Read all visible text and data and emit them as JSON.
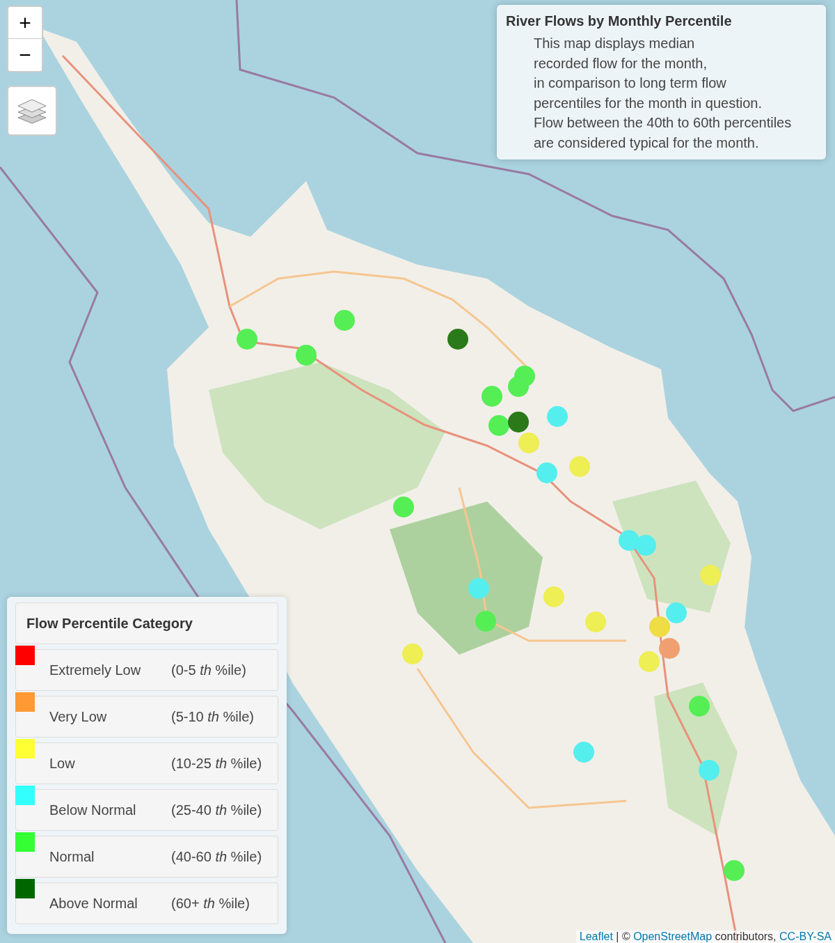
{
  "zoom_controls": {
    "zoom_in": "+",
    "zoom_out": "−"
  },
  "info_box": {
    "title": "River Flows by Monthly Percentile",
    "lines": [
      "This map displays median",
      "recorded flow for the month,",
      "in comparison to long term flow",
      "percentiles for the month in question.",
      "Flow between the 40th to 60th percentiles",
      "are considered typical for the month."
    ]
  },
  "markers": [
    {
      "color": "#55ee55"
    },
    {
      "color": "#55ee55"
    },
    {
      "color": "#55ee55"
    },
    {
      "color": "#2a7a1a"
    },
    {
      "color": "#55ee55"
    },
    {
      "color": "#55ee55"
    },
    {
      "color": "#55ee55"
    },
    {
      "color": "#55ee55"
    },
    {
      "color": "#eeee55"
    },
    {
      "color": "#2a7a1a"
    },
    {
      "color": "#55eeee"
    },
    {
      "color": "#55eeee"
    },
    {
      "color": "#eeee55"
    },
    {
      "color": "#55ee55"
    },
    {
      "color": "#55eeee"
    },
    {
      "color": "#55eeee"
    },
    {
      "color": "#eeee55"
    },
    {
      "color": "#55eeee"
    },
    {
      "color": "#eeee55"
    },
    {
      "color": "#55ee55"
    },
    {
      "color": "#eeee55"
    },
    {
      "color": "#55eeee"
    },
    {
      "color": "#f0a070"
    },
    {
      "color": "#eedd44"
    },
    {
      "color": "#eeee55"
    },
    {
      "color": "#eeee55"
    },
    {
      "color": "#55ee55"
    },
    {
      "color": "#55eeee"
    },
    {
      "color": "#55eeee"
    },
    {
      "color": "#55ee55"
    }
  ],
  "legend": {
    "title": "Flow Percentile Category",
    "items": [
      {
        "label": "Extremely Low",
        "range": "(0-5 *th* %ile)",
        "color": "#ff0000"
      },
      {
        "label": "Very Low",
        "range": "(5-10 *th* %ile)",
        "color": "#ff9933"
      },
      {
        "label": "Low",
        "range": "(10-25 *th* %ile)",
        "color": "#ffff33"
      },
      {
        "label": "Below Normal",
        "range": "(25-40 *th* %ile)",
        "color": "#33ffff"
      },
      {
        "label": "Normal",
        "range": "(40-60 *th* %ile)",
        "color": "#33ff33"
      },
      {
        "label": "Above Normal",
        "range": "(60+ *th* %ile)",
        "color": "#006600"
      }
    ]
  },
  "attribution": {
    "leaflet": "Leaflet",
    "separator": " | © ",
    "osm": "OpenStreetMap",
    "contributors": " contributors, ",
    "license": "CC-BY-SA"
  }
}
